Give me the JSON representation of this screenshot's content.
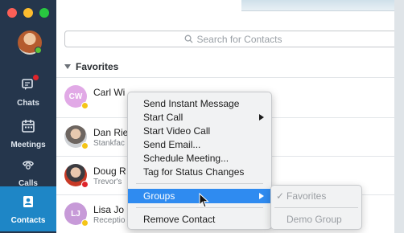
{
  "sidebar": {
    "nav": [
      {
        "label": "Chats",
        "icon": "chat-icon"
      },
      {
        "label": "Meetings",
        "icon": "calendar-icon"
      },
      {
        "label": "Calls",
        "icon": "phone-icon"
      },
      {
        "label": "Contacts",
        "icon": "contacts-icon"
      }
    ],
    "active": "Contacts",
    "colors": {
      "sidebar": "#25364c",
      "active": "#1e86c6"
    }
  },
  "search": {
    "placeholder": "Search for Contacts"
  },
  "favorites": {
    "header": "Favorites"
  },
  "contacts": [
    {
      "initials": "CW",
      "name": "Carl Wi",
      "subtitle": "",
      "presence": "away",
      "avatar_color": "#e1a9e6"
    },
    {
      "initials": "",
      "name": "Dan Rie",
      "subtitle": "Stankfac",
      "presence": "away",
      "avatar_color": "#9b8f86"
    },
    {
      "initials": "",
      "name": "Doug R",
      "subtitle": "Trevor's",
      "presence": "busy",
      "avatar_color": "#b8432f"
    },
    {
      "initials": "LJ",
      "name": "Lisa Jo",
      "subtitle": "Receptio",
      "presence": "away",
      "avatar_color": "#c79ad8"
    }
  ],
  "context_menu": {
    "items": [
      "Send Instant Message",
      "Start Call",
      "Start Video Call",
      "Send Email...",
      "Schedule Meeting...",
      "Tag for Status Changes"
    ],
    "groups_label": "Groups",
    "remove_label": "Remove Contact"
  },
  "groups_submenu": {
    "items": [
      {
        "label": "Favorites",
        "checked": true
      },
      {
        "label": "Demo Group",
        "checked": false
      }
    ],
    "check_glyph": "✓"
  },
  "presence_colors": {
    "away": "#f5c518",
    "busy": "#e0242b",
    "available": "#5bc236"
  }
}
